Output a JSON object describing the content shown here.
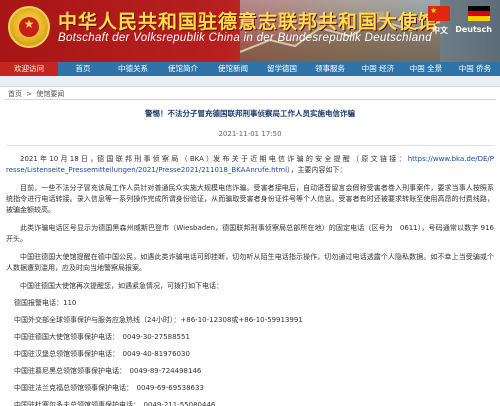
{
  "header": {
    "title_cn": "中华人民共和国驻德意志联邦共和国大使馆",
    "title_de": "Botschaft der Volksrepublik China in der Bundesrepublik Deutschland",
    "lang_cn": "中文",
    "lang_de": "Deutsch"
  },
  "nav": {
    "items": [
      {
        "label": "欢迎访问",
        "active": true
      },
      {
        "label": "首页"
      },
      {
        "label": "中德关系"
      },
      {
        "label": "使馆简介"
      },
      {
        "label": "使馆新闻"
      },
      {
        "label": "留学德国"
      },
      {
        "label": "领事服务"
      },
      {
        "label": "中国 经济"
      },
      {
        "label": "中国 全景"
      },
      {
        "label": "中国 侨务"
      }
    ]
  },
  "breadcrumb": {
    "home": "首页",
    "sep": ">",
    "current": "使馆要闻"
  },
  "article": {
    "title": "警惕！不法分子冒充德国联邦刑事侦察局工作人员实施电信诈骗",
    "date": "2021-11-01 17:50",
    "p1_text": "2021 年 10 月 18 日 ，德 国 联 邦 刑 事 侦 察 局 （ BKA ）发 布 关 于 近 期 电 信 诈 骗 的 安 全 提 醒 （ 原 文 链 接 ：",
    "p1_link": "https://www.bka.de/DE/Presse/Listenseite_Pressemitteilungen/2021/Presse2021/211018_BKAAnrufe.html",
    "p1_tail": "），主要内容如下：",
    "p2": "目前，一些不法分子冒充该局工作人员针对普通民众实施大规模电信诈骗。受害者接电后，自动语音留言会假称受害者卷入刑事案件，要求当事人按照系统指令进行电话转接。录入信息等一系列操作完成所谓身份验证，从而骗取受害者身份证件号等个人信息。受害者有时还被要求转账至使用高昂的付费线路，被骗金额较高。",
    "p3": "此类诈骗电话区号显示为德国黑森州威斯巴登市（Wiesbaden，德国联邦刑事侦察局总部所在地）的固定电话（区号为　0611），号码通常以数字 916 开头。",
    "p4": "中国驻德国大使馆提醒在德中国公民，如遇此类诈骗电话可即挂断，切勿听从陌生电话指示操作，切勿通过电话透露个人隐私数据。如不幸上当受骗或个人数据遭到滥用，应及时向当地警察局报案。",
    "p5": "中国驻德国大使馆再次提醒您，如遇紧急情况，可拨打如下电话：",
    "contacts": [
      "德国报警电话：110",
      "中国外交部全球领事保护与服务应急热线（24小时）：+86-10-12308或+86-10-59913991",
      "中国驻德国大使馆领事保护电话：　0049-30-27588551",
      "中国驻汉堡总领馆领事保护电话：　0049-40-81976030",
      "中国驻慕尼黑总领馆领事保护电话：　0049-89-724498146",
      "中国驻法兰克福总领馆领事保护电话：　0049-69-69538633",
      "中国驻杜塞尔多夫总领馆领事保护电话：　0049-211-55080446"
    ]
  },
  "colors": {
    "banner_red": "#b82020",
    "nav_blue": "#2f74a8",
    "nav_active": "#c3261c",
    "title_gold": "#ffdd4d",
    "link_blue": "#1a4ea2"
  },
  "icons": {
    "emblem": "national-emblem",
    "flag_cn": "china-flag-icon",
    "flag_de": "germany-flag-icon"
  }
}
